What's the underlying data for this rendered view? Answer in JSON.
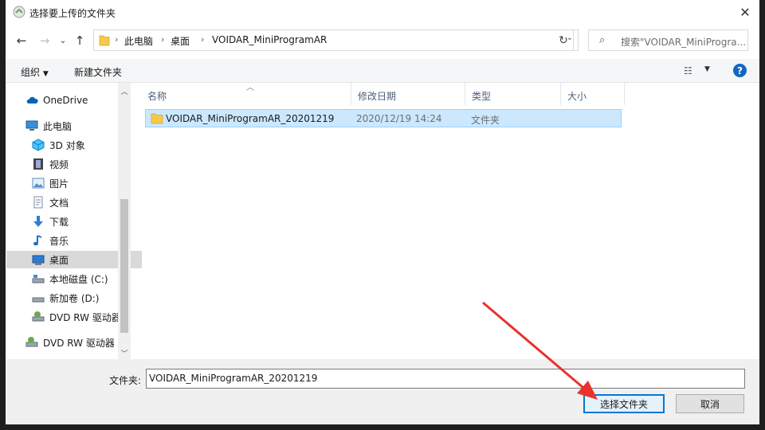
{
  "window": {
    "title": "选择要上传的文件夹"
  },
  "address": {
    "crumbs": [
      "此电脑",
      "桌面",
      "VOIDAR_MiniProgramAR"
    ]
  },
  "search": {
    "placeholder": "搜索\"VOIDAR_MiniProgra..."
  },
  "toolbar": {
    "organize": "组织",
    "new_folder": "新建文件夹"
  },
  "sidebar": {
    "items": [
      {
        "label": "OneDrive",
        "icon": "cloud-icon"
      },
      {
        "label": "此电脑",
        "icon": "computer-icon"
      },
      {
        "label": "3D 对象",
        "icon": "cube-icon"
      },
      {
        "label": "视频",
        "icon": "film-icon"
      },
      {
        "label": "图片",
        "icon": "picture-icon"
      },
      {
        "label": "文档",
        "icon": "document-icon"
      },
      {
        "label": "下载",
        "icon": "download-arrow-icon"
      },
      {
        "label": "音乐",
        "icon": "music-note-icon"
      },
      {
        "label": "桌面",
        "icon": "desktop-icon"
      },
      {
        "label": "本地磁盘 (C:)",
        "icon": "drive-icon"
      },
      {
        "label": "新加卷 (D:)",
        "icon": "drive-icon"
      },
      {
        "label": "DVD RW 驱动器",
        "icon": "dvd-icon"
      },
      {
        "label": "DVD RW 驱动器",
        "icon": "dvd-icon"
      }
    ],
    "selected_index": 8
  },
  "columns": [
    "名称",
    "修改日期",
    "类型",
    "大小"
  ],
  "files": [
    {
      "name": "VOIDAR_MiniProgramAR_20201219",
      "modified": "2020/12/19 14:24",
      "type": "文件夹",
      "size": ""
    }
  ],
  "footer": {
    "folder_label": "文件夹:",
    "folder_value": "VOIDAR_MiniProgramAR_20201219",
    "select_button": "选择文件夹",
    "cancel_button": "取消"
  },
  "colors": {
    "accent": "#0078d7",
    "selection": "#cce8ff",
    "annotation_arrow": "#e8322b",
    "folder": "#f5c94a"
  }
}
